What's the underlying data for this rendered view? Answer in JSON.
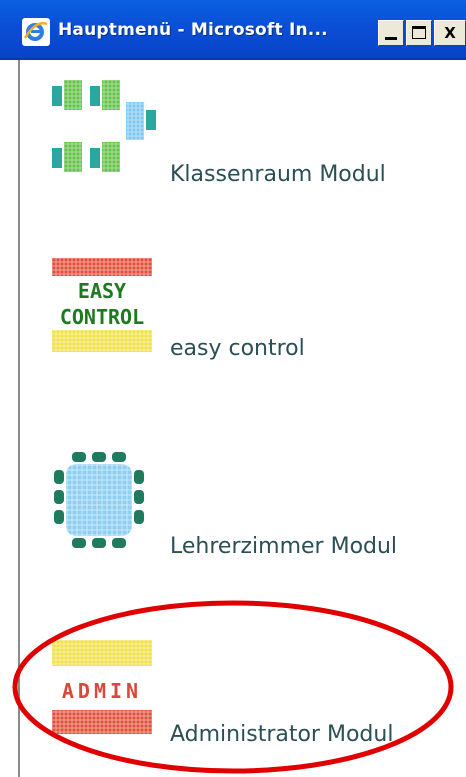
{
  "window": {
    "title": "Hauptmenü - Microsoft In...",
    "minimize_glyph": "_",
    "maximize_glyph": "□",
    "close_glyph": "X"
  },
  "menu": {
    "items": [
      {
        "label": "Klassenraum Modul",
        "icon": "classroom-grid-icon"
      },
      {
        "label": "easy control",
        "icon": "easy-control-logo-icon",
        "logo_lines": [
          "EASY",
          "CONTROL"
        ]
      },
      {
        "label": "Lehrerzimmer Modul",
        "icon": "staffroom-table-icon"
      },
      {
        "label": "Administrator Modul",
        "icon": "admin-logo-icon",
        "logo_text": "ADMIN"
      }
    ]
  },
  "annotation": {
    "shape": "red-ellipse",
    "color": "#e00000"
  },
  "colors": {
    "titlebar": "#0a4fd6",
    "label_text": "#2a4f55",
    "logo_green": "#1e7a1e",
    "logo_red": "#d9483a",
    "logo_yellow": "#f2e24a"
  }
}
